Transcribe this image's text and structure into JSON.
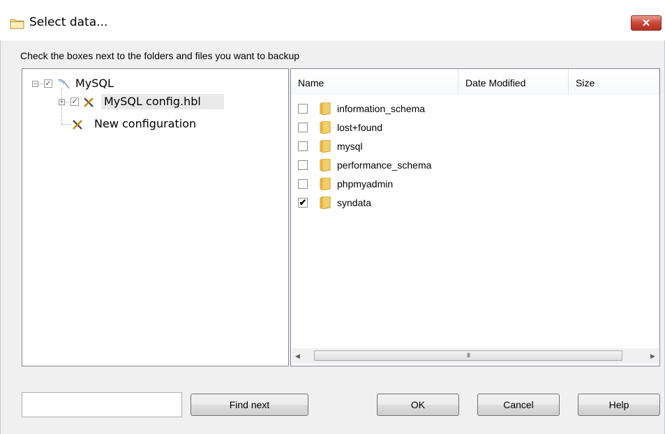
{
  "window": {
    "title": "Select data...",
    "close_label": "✕"
  },
  "instruction": "Check the boxes next to the folders and files you want to backup",
  "tree": {
    "root": {
      "label": "MySQL",
      "checked": true,
      "expander": "−"
    },
    "child1": {
      "label": "MySQL config.hbl",
      "checked": true,
      "expander": "+"
    },
    "child2": {
      "label": "New configuration"
    }
  },
  "file_list": {
    "columns": [
      "Name",
      "Date Modified",
      "Size"
    ],
    "items": [
      {
        "name": "information_schema",
        "checked": false,
        "mark": ""
      },
      {
        "name": "lost+found",
        "checked": false,
        "mark": ""
      },
      {
        "name": "mysql",
        "checked": false,
        "mark": ""
      },
      {
        "name": "performance_schema",
        "checked": false,
        "mark": ""
      },
      {
        "name": "phpmyadmin",
        "checked": false,
        "mark": ""
      },
      {
        "name": "syndata",
        "checked": true,
        "mark": "✔"
      }
    ],
    "scroll_left": "◀",
    "scroll_right": "▶",
    "scroll_grip": "III"
  },
  "search": {
    "value": ""
  },
  "buttons": {
    "find_next": "Find next",
    "ok": "OK",
    "cancel": "Cancel",
    "help": "Help"
  },
  "icons": {
    "title": "folder-icon",
    "root": "database-icon",
    "config": "tools-icon",
    "file": "folder-icon"
  }
}
